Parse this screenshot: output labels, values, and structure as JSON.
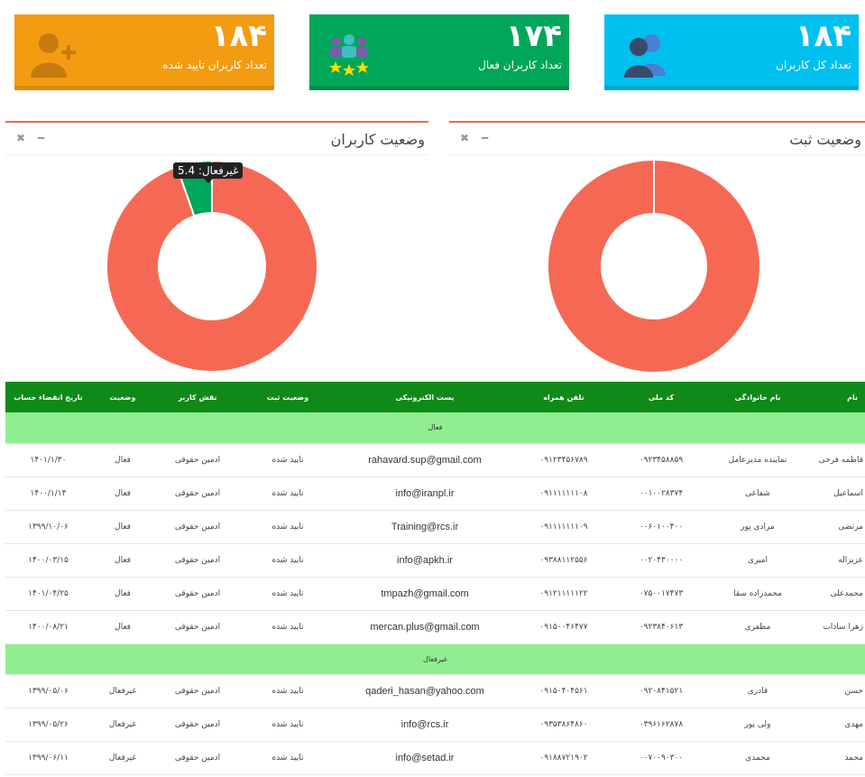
{
  "stats": [
    {
      "number": "۱۸۴",
      "label": "تعداد کل کاربران",
      "color": "#00c0ef",
      "bar_color": "#00a7d0",
      "icon": "users-icon"
    },
    {
      "number": "۱۷۴",
      "label": "تعداد کاربران فعال",
      "color": "#00a65a",
      "bar_color": "#008d4c",
      "icon": "users-stars-icon"
    },
    {
      "number": "۱۸۴",
      "label": "تعداد کاربران تایید شده",
      "color": "#f39c12",
      "bar_color": "#db8b0b",
      "icon": "add-user-icon"
    }
  ],
  "panels": {
    "registration": {
      "title": "وضعیت ثبت",
      "close_icon": "close-icon",
      "minimize_icon": "minimize-icon"
    },
    "users": {
      "title": "وضعیت کاربران",
      "close_icon": "close-icon",
      "minimize_icon": "minimize-icon",
      "tooltip": "غیرفعال: 5.4"
    }
  },
  "chart_data": [
    {
      "type": "pie",
      "subtype": "donut",
      "title": "وضعیت ثبت",
      "series": [
        {
          "values": [
            100
          ]
        }
      ],
      "colors": [
        "#f56954"
      ]
    },
    {
      "type": "pie",
      "subtype": "donut",
      "title": "وضعیت کاربران",
      "categories": [
        "فعال",
        "غیرفعال"
      ],
      "series": [
        {
          "values": [
            94.6,
            5.4
          ]
        }
      ],
      "colors": [
        "#f56954",
        "#00a65a"
      ]
    }
  ],
  "table": {
    "headers": [
      "نام",
      "نام خانوادگی",
      "کد ملی",
      "تلفن همراه",
      "پست الکترونیکی",
      "وضعیت ثبت",
      "نقش کاربر",
      "وضعیت",
      "تاریخ انقضاء حساب"
    ],
    "groups": [
      {
        "label": "فعال",
        "rows": [
          [
            "فاطمه فرخی",
            "نماینده مدیرعامل",
            "۰۹۲۳۴۵۸۸۵۹",
            "۰۹۱۲۳۴۵۶۷۸۹",
            "rahavard.sup@gmail.com",
            "تایید شده",
            "ادمین حقوقی",
            "فعال",
            "۱۴۰۱/۱/۳۰"
          ],
          [
            "اسماعیل",
            "شفاعی",
            "۰۰۱۰۰۲۸۳۷۴",
            "۰۹۱۱۱۱۱۱۱۰۸",
            "info@iranpl.ir",
            "تایید شده",
            "ادمین حقوقی",
            "فعال",
            "۱۴۰۰/۱/۱۴"
          ],
          [
            "مرتضی",
            "مرادی پور",
            "۰۰۶۰۱۰۰۴۰۰",
            "۰۹۱۱۱۱۱۱۱۰۹",
            "Training@rcs.ir",
            "تایید شده",
            "ادمین حقوقی",
            "فعال",
            "۱۳۹۹/۱۰/۰۶"
          ],
          [
            "عزیزاله",
            "امیری",
            "۰۰۲۰۴۳۰۰۰۰",
            "۰۹۳۸۸۱۱۲۵۵۶",
            "info@apkh.ir",
            "تایید شده",
            "ادمین حقوقی",
            "فعال",
            "۱۴۰۰/۰۳/۱۵"
          ],
          [
            "محمدعلی",
            "محمدزاده سقا",
            "۰۷۵۰۰۱۷۴۷۳",
            "۰۹۱۲۱۱۱۱۱۲۲",
            "tmpazh@gmail.com",
            "تایید شده",
            "ادمین حقوقی",
            "فعال",
            "۱۴۰۱/۰۴/۲۵"
          ],
          [
            "زهرا سادات",
            "مظفری",
            "۰۹۲۳۸۴۰۶۱۳",
            "۰۹۱۵۰۰۴۶۴۷۷",
            "mercan.plus@gmail.com",
            "تایید شده",
            "ادمین حقوقی",
            "فعال",
            "۱۴۰۰/۰۸/۲۱"
          ]
        ]
      },
      {
        "label": "غیرفعال",
        "rows": [
          [
            "حسن",
            "قادری",
            "۰۹۲۰۸۴۱۵۲۱",
            "۰۹۱۵۰۴۰۴۵۶۱",
            "qaderi_hasan@yahoo.com",
            "تایید شده",
            "ادمین حقوقی",
            "غیرفعال",
            "۱۳۹۹/۰۵/۰۶"
          ],
          [
            "مهدی",
            "ولی پور",
            "۰۳۹۶۱۶۲۸۷۸",
            "۰۹۳۵۳۸۶۴۸۶۰",
            "info@rcs.ir",
            "تایید شده",
            "ادمین حقوقی",
            "غیرفعال",
            "۱۳۹۹/۰۵/۲۶"
          ],
          [
            "محمد",
            "محمدی",
            "۰۰۷۰۰۹۰۳۰۰",
            "۰۹۱۸۸۷۲۱۹۰۲",
            "info@setad.ir",
            "تایید شده",
            "ادمین حقوقی",
            "غیرفعال",
            "۱۳۹۹/۰۶/۱۱"
          ]
        ]
      }
    ]
  }
}
